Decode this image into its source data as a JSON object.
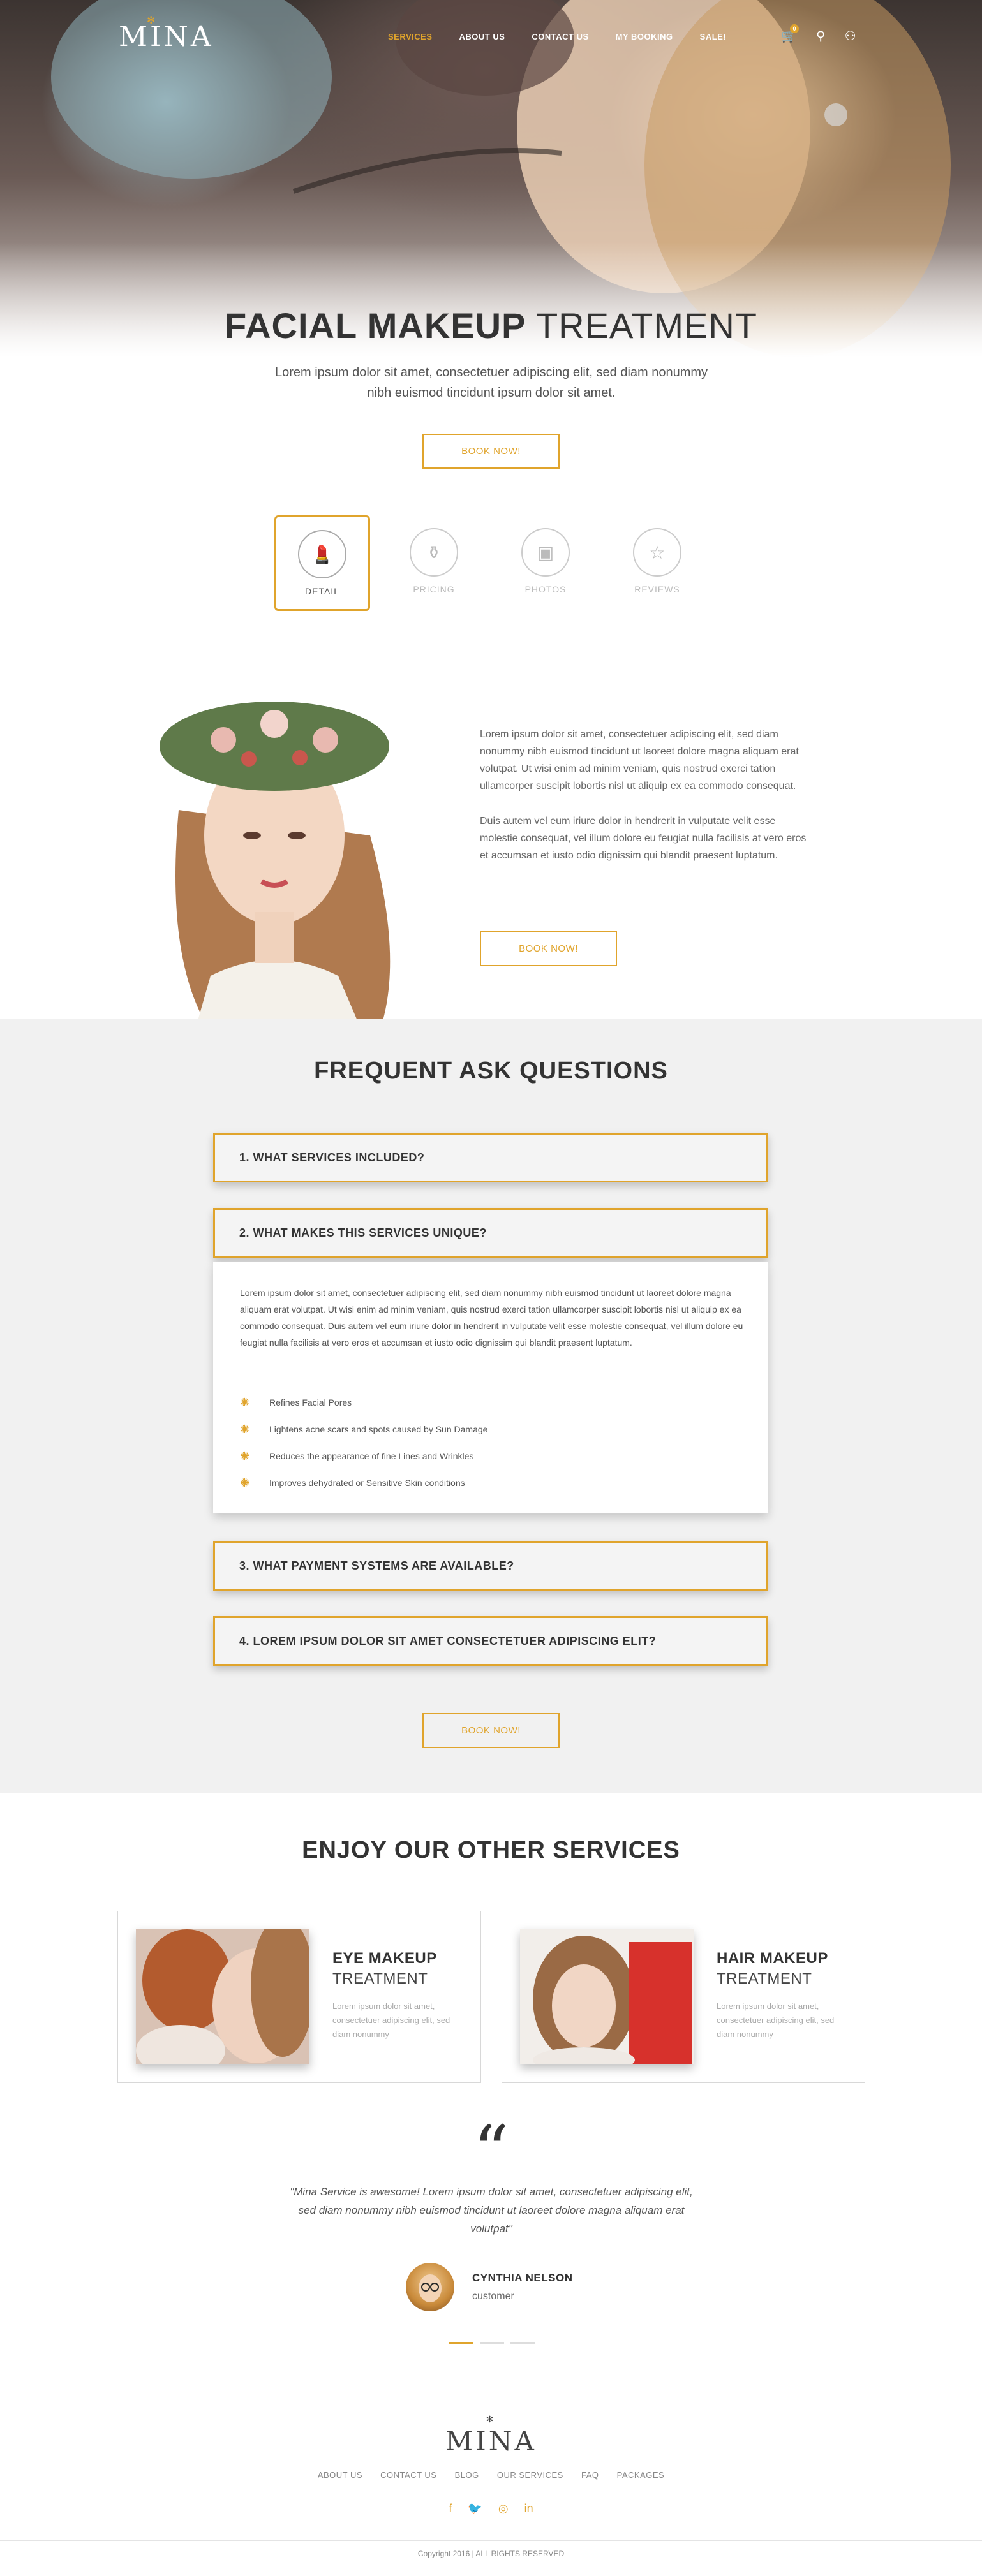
{
  "header": {
    "logo": "MINA",
    "nav": [
      {
        "label": "SERVICES",
        "active": true
      },
      {
        "label": "ABOUT US",
        "active": false
      },
      {
        "label": "CONTACT US",
        "active": false
      },
      {
        "label": "MY BOOKING",
        "active": false
      },
      {
        "label": "SALE!",
        "active": false
      }
    ],
    "cart_count": "0",
    "icons": [
      "cart-icon",
      "search-icon",
      "user-icon"
    ],
    "accent_color": "#e0a42c"
  },
  "hero": {
    "title_bold": "FACIAL MAKEUP",
    "title_light": "TREATMENT",
    "subtitle": "Lorem ipsum dolor sit amet, consectetuer adipiscing elit, sed diam nonummy nibh euismod tincidunt ipsum dolor sit amet.",
    "button": "BOOK NOW!"
  },
  "tabs": [
    {
      "label": "DETAIL",
      "icon": "lipstick-icon",
      "active": true
    },
    {
      "label": "PRICING",
      "icon": "bottle-icon",
      "active": false
    },
    {
      "label": "PHOTOS",
      "icon": "photos-icon",
      "active": false
    },
    {
      "label": "REVIEWS",
      "icon": "star-icon",
      "active": false
    }
  ],
  "detail": {
    "paragraphs": [
      "Lorem ipsum dolor sit amet, consectetuer adipiscing elit, sed diam nonummy nibh euismod tincidunt ut laoreet dolore magna aliquam erat volutpat. Ut wisi enim ad minim veniam, quis nostrud exerci tation ullamcorper suscipit lobortis nisl ut aliquip ex ea commodo consequat.",
      "Duis autem vel eum iriure dolor in hendrerit in vulputate velit esse molestie consequat, vel illum dolore eu feugiat nulla facilisis at vero eros et accumsan et iusto odio dignissim qui blandit praesent luptatum."
    ],
    "button": "BOOK NOW!"
  },
  "faq": {
    "title_bold": "FREQUENT ASK",
    "title_light": "QUESTIONS",
    "items": [
      {
        "q": "1. WHAT SERVICES INCLUDED?"
      },
      {
        "q": "2. WHAT MAKES THIS SERVICES UNIQUE?"
      },
      {
        "q": "3. WHAT PAYMENT SYSTEMS ARE AVAILABLE?"
      },
      {
        "q": "4. LOREM IPSUM DOLOR SIT AMET CONSECTETUER ADIPISCING ELIT?"
      }
    ],
    "open_answer": "Lorem ipsum dolor sit amet, consectetuer adipiscing elit, sed diam nonummy nibh euismod tincidunt ut laoreet dolore magna aliquam erat volutpat. Ut wisi enim ad minim veniam, quis nostrud exerci tation ullamcorper suscipit lobortis nisl ut aliquip ex ea commodo consequat. Duis autem vel eum iriure dolor in hendrerit in vulputate velit esse molestie consequat, vel illum dolore eu feugiat nulla facilisis at vero eros et accumsan et iusto odio dignissim qui blandit praesent luptatum.",
    "bullets": [
      "Refines Facial Pores",
      "Lightens acne scars and spots caused by Sun Damage",
      "Reduces the appearance of fine Lines and Wrinkles",
      "Improves dehydrated or Sensitive Skin conditions"
    ],
    "button": "BOOK NOW!"
  },
  "other_services": {
    "title_bold": "ENJOY OUR",
    "title_light": "OTHER SERVICES",
    "cards": [
      {
        "title": "EYE MAKEUP",
        "subtitle": "TREATMENT",
        "desc": "Lorem ipsum dolor sit amet, consectetuer adipiscing elit, sed diam nonummy"
      },
      {
        "title": "HAIR MAKEUP",
        "subtitle": "TREATMENT",
        "desc": "Lorem ipsum dolor sit amet, consectetuer adipiscing elit, sed diam nonummy"
      }
    ]
  },
  "testimonial": {
    "quote_mark": "“",
    "text": "\"Mina Service is awesome! Lorem ipsum dolor sit amet, consectetuer adipiscing elit, sed diam nonummy nibh euismod tincidunt ut laoreet dolore magna aliquam erat volutpat\"",
    "name": "CYNTHIA NELSON",
    "role": "customer"
  },
  "footer": {
    "logo": "MINA",
    "links": [
      "ABOUT US",
      "CONTACT US",
      "BLOG",
      "OUR SERVICES",
      "FAQ",
      "PACKAGES"
    ],
    "social": [
      "facebook-icon",
      "twitter-icon",
      "instagram-icon",
      "linkedin-icon"
    ],
    "copyright": "Copyright 2016 | ALL RIGHTS RESERVED"
  }
}
